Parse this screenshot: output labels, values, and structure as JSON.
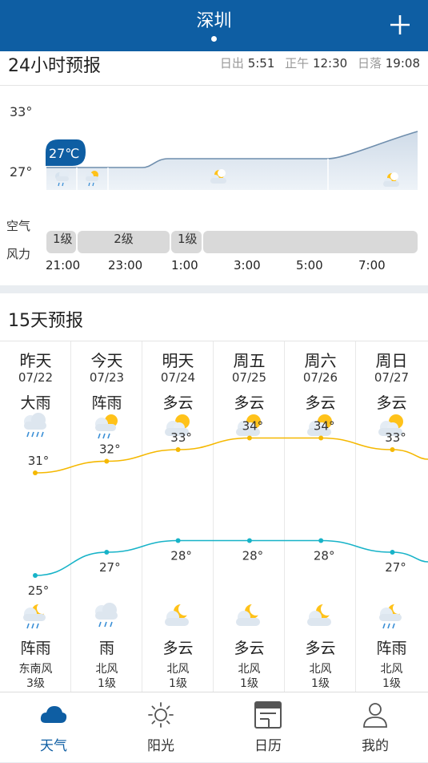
{
  "header": {
    "city": "深圳"
  },
  "hourly": {
    "title": "24小时预报",
    "sunrise_label": "日出",
    "sunrise": "5:51",
    "noon_label": "正午",
    "noon": "12:30",
    "sunset_label": "日落",
    "sunset": "19:08",
    "y_high": "33°",
    "y_low": "27°",
    "current_temp": "27℃",
    "air_label": "空气",
    "wind_label": "风力",
    "wind_segments": [
      "1级",
      "2级",
      "1级"
    ],
    "times": [
      "21:00",
      "23:00",
      "1:00",
      "3:00",
      "5:00",
      "7:00"
    ]
  },
  "daily": {
    "title": "15天预报",
    "days": [
      {
        "name": "昨天",
        "date": "07/22",
        "day_weather": "大雨",
        "day_icon": "heavy-rain-icon",
        "high": "31°",
        "low": "25°",
        "night_icon": "night-shower-icon",
        "night_weather": "阵雨",
        "wind_dir": "东南风",
        "wind_level": "3级"
      },
      {
        "name": "今天",
        "date": "07/23",
        "day_weather": "阵雨",
        "day_icon": "shower-icon",
        "high": "32°",
        "low": "27°",
        "night_icon": "rain-icon",
        "night_weather": "雨",
        "wind_dir": "北风",
        "wind_level": "1级"
      },
      {
        "name": "明天",
        "date": "07/24",
        "day_weather": "多云",
        "day_icon": "partly-cloudy-icon",
        "high": "33°",
        "low": "28°",
        "night_icon": "night-cloudy-icon",
        "night_weather": "多云",
        "wind_dir": "北风",
        "wind_level": "1级"
      },
      {
        "name": "周五",
        "date": "07/25",
        "day_weather": "多云",
        "day_icon": "partly-cloudy-icon",
        "high": "34°",
        "low": "28°",
        "night_icon": "night-cloudy-icon",
        "night_weather": "多云",
        "wind_dir": "北风",
        "wind_level": "1级"
      },
      {
        "name": "周六",
        "date": "07/26",
        "day_weather": "多云",
        "day_icon": "partly-cloudy-icon",
        "high": "34°",
        "low": "28°",
        "night_icon": "night-cloudy-icon",
        "night_weather": "多云",
        "wind_dir": "北风",
        "wind_level": "1级"
      },
      {
        "name": "周日",
        "date": "07/27",
        "day_weather": "多云",
        "day_icon": "partly-cloudy-icon",
        "high": "33°",
        "low": "27°",
        "night_icon": "night-shower-icon",
        "night_weather": "阵雨",
        "wind_dir": "北风",
        "wind_level": "1级"
      }
    ]
  },
  "nav": {
    "items": [
      {
        "label": "天气",
        "icon": "cloud-icon",
        "active": true
      },
      {
        "label": "阳光",
        "icon": "sun-icon",
        "active": false
      },
      {
        "label": "日历",
        "icon": "calendar-icon",
        "active": false
      },
      {
        "label": "我的",
        "icon": "user-icon",
        "active": false
      }
    ]
  },
  "colors": {
    "brand": "#0e5ea3",
    "high_line": "#f5b800",
    "low_line": "#17b3c8"
  }
}
